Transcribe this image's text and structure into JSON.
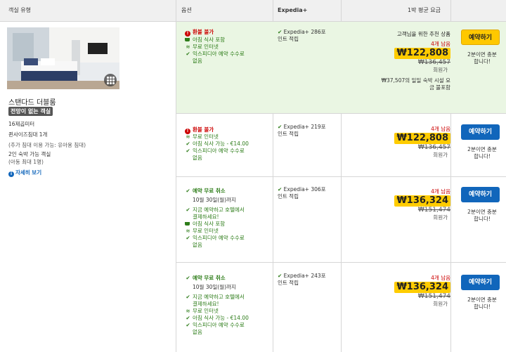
{
  "header": {
    "room_type": "객실 유형",
    "options": "옵션",
    "expedia": "Expedia+",
    "price": "1박 평균 요금"
  },
  "room": {
    "title": "스탠다드 더블룸",
    "badge": "전망이 없는 객실",
    "size": "16제곱미터",
    "bed": "퀸사이즈침대 1개",
    "bed_note": "(추가 침대 이용 가능: 유아용 침대)",
    "occupancy": "2인 숙박 가능 객실",
    "occupancy_note": "(아동 최대 1명)",
    "more_link": "자세히 보기"
  },
  "rows": [
    {
      "policy": "환불 불가",
      "features": [
        "아침 식사 포함",
        "무료 인터넷",
        "익스피디아 예약 수수료",
        "없음"
      ],
      "points_1": "Expedia+ 286포",
      "points_2": "인트 적립",
      "recommended": "고객님을 위한 추천 상품",
      "left": "4개 남음",
      "price": "₩122,808",
      "old_price": "₩136,457",
      "member": "회원가",
      "note_1": "₩37,507의 일일 숙박 시설 요",
      "note_2": "금 불포함",
      "button": "예약하기",
      "stock_1": "2분이면 충분",
      "stock_2": "합니다!"
    },
    {
      "policy": "환불 불가",
      "features": [
        "무료 인터넷",
        "아침 식사 가능 - €14.00",
        "익스피디아 예약 수수료",
        "없음"
      ],
      "points_1": "Expedia+ 219포",
      "points_2": "인트 적립",
      "left": "4개 남음",
      "price": "₩122,808",
      "old_price": "₩136,457",
      "member": "회원가",
      "button": "예약하기",
      "stock_1": "2분이면 충분",
      "stock_2": "합니다!"
    },
    {
      "policy": "예약 무료 취소",
      "until": "10월 30일(월)까지",
      "features": [
        "지금 예약하고 호텔에서",
        "결제하세요!",
        "아침 식사 포함",
        "무료 인터넷",
        "익스피디아 예약 수수료",
        "없음"
      ],
      "points_1": "Expedia+ 306포",
      "points_2": "인트 적립",
      "left": "4개 남음",
      "price": "₩136,324",
      "old_price": "₩151,474",
      "member": "회원가",
      "button": "예약하기",
      "stock_1": "2분이면 충분",
      "stock_2": "합니다!"
    },
    {
      "policy": "예약 무료 취소",
      "until": "10월 30일(월)까지",
      "features": [
        "지금 예약하고 호텔에서",
        "결제하세요!",
        "무료 인터넷",
        "아침 식사 가능 - €14.00",
        "익스피디아 예약 수수료",
        "없음"
      ],
      "points_1": "Expedia+ 243포",
      "points_2": "인트 적립",
      "left": "4개 남음",
      "price": "₩136,324",
      "old_price": "₩151,474",
      "member": "회원가",
      "button": "예약하기",
      "stock_1": "2분이면 충분",
      "stock_2": "합니다!"
    }
  ],
  "colors": {
    "accent_blue": "#1166bb",
    "price_yellow": "#ffcc00",
    "green": "#2e7d1a",
    "red": "#cc0000",
    "recommended_bg": "#eaf6e3"
  }
}
